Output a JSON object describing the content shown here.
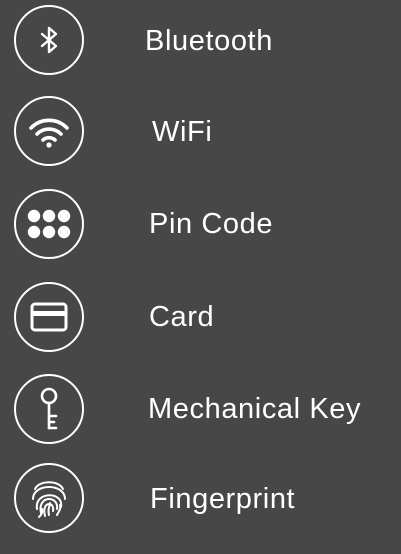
{
  "background_color": "#474747",
  "foreground_color": "#ffffff",
  "items": [
    {
      "label": "Bluetooth",
      "icon": "bluetooth-icon"
    },
    {
      "label": "WiFi",
      "icon": "wifi-icon"
    },
    {
      "label": "Pin Code",
      "icon": "keypad-icon"
    },
    {
      "label": "Card",
      "icon": "card-icon"
    },
    {
      "label": "Mechanical Key",
      "icon": "key-icon"
    },
    {
      "label": "Fingerprint",
      "icon": "fingerprint-icon"
    }
  ]
}
